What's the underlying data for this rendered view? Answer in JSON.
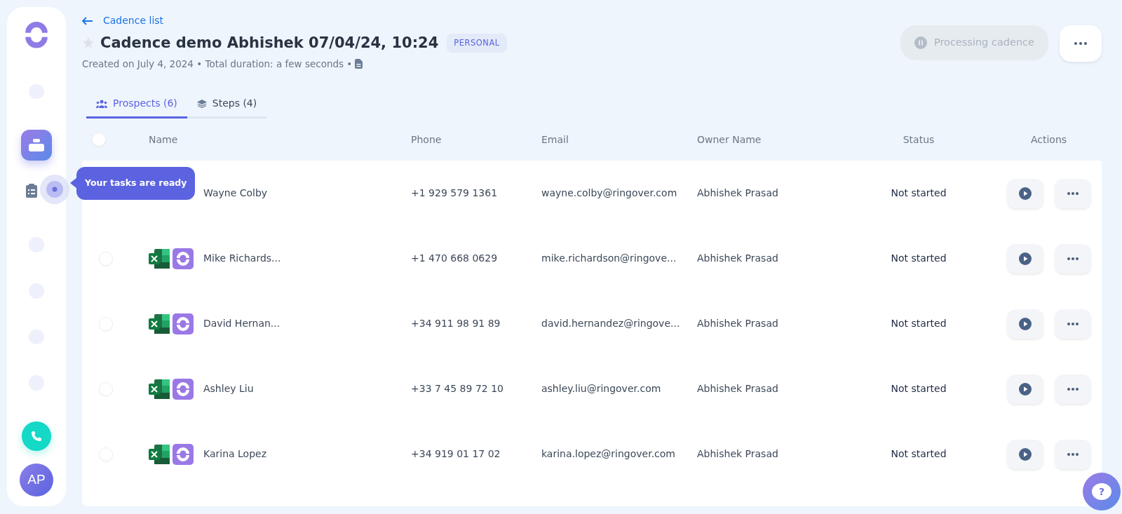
{
  "sidebar": {
    "nav": [
      {
        "kind": "dot",
        "selected": false
      },
      {
        "kind": "cadence",
        "selected": true
      },
      {
        "kind": "tasks",
        "selected": false
      },
      {
        "kind": "dot",
        "selected": false
      },
      {
        "kind": "dot",
        "selected": false
      },
      {
        "kind": "dot",
        "selected": false
      },
      {
        "kind": "dot",
        "selected": false
      }
    ],
    "avatar": "AP"
  },
  "tooltip": "Your tasks are ready",
  "back_link": "Cadence list",
  "title": {
    "text": "Cadence demo Abhishek 07/04/24, 10:24",
    "starred": false,
    "badge": "PERSONAL"
  },
  "meta": "Created on July 4, 2024 • Total duration: a few seconds •",
  "processing_button": {
    "label": "Processing cadence",
    "disabled": true
  },
  "tabs": [
    {
      "label": "Prospects (6)",
      "kind": "people",
      "selected": true
    },
    {
      "label": "Steps (4)",
      "kind": "layers",
      "selected": false
    }
  ],
  "table": {
    "select_all_checked": false,
    "columns": [
      "Name",
      "Phone",
      "Email",
      "Owner Name",
      "Status",
      "Actions"
    ],
    "rows": [
      {
        "name": "Wayne Colby",
        "source_icons": false,
        "phone": "+1 929 579 1361",
        "email": "wayne.colby@ringover.com",
        "owner": "Abhishek Prasad",
        "status": "Not started"
      },
      {
        "checked": false,
        "name": "Mike Richards...",
        "source_icons": true,
        "phone": "+1 470 668 0629",
        "email": "mike.richardson@ringove...",
        "owner": "Abhishek Prasad",
        "status": "Not started"
      },
      {
        "checked": false,
        "name": "David Hernan...",
        "source_icons": true,
        "phone": "+34 911 98 91 89",
        "email": "david.hernandez@ringove...",
        "owner": "Abhishek Prasad",
        "status": "Not started"
      },
      {
        "checked": false,
        "name": "Ashley Liu",
        "source_icons": true,
        "phone": "+33 7 45 89 72 10",
        "email": "ashley.liu@ringover.com",
        "owner": "Abhishek Prasad",
        "status": "Not started"
      },
      {
        "checked": false,
        "name": "Karina Lopez",
        "source_icons": true,
        "phone": "+34 919 01 17 02",
        "email": "karina.lopez@ringover.com",
        "owner": "Abhishek Prasad",
        "status": "Not started"
      }
    ]
  },
  "help_button": {
    "symbol": "?"
  }
}
